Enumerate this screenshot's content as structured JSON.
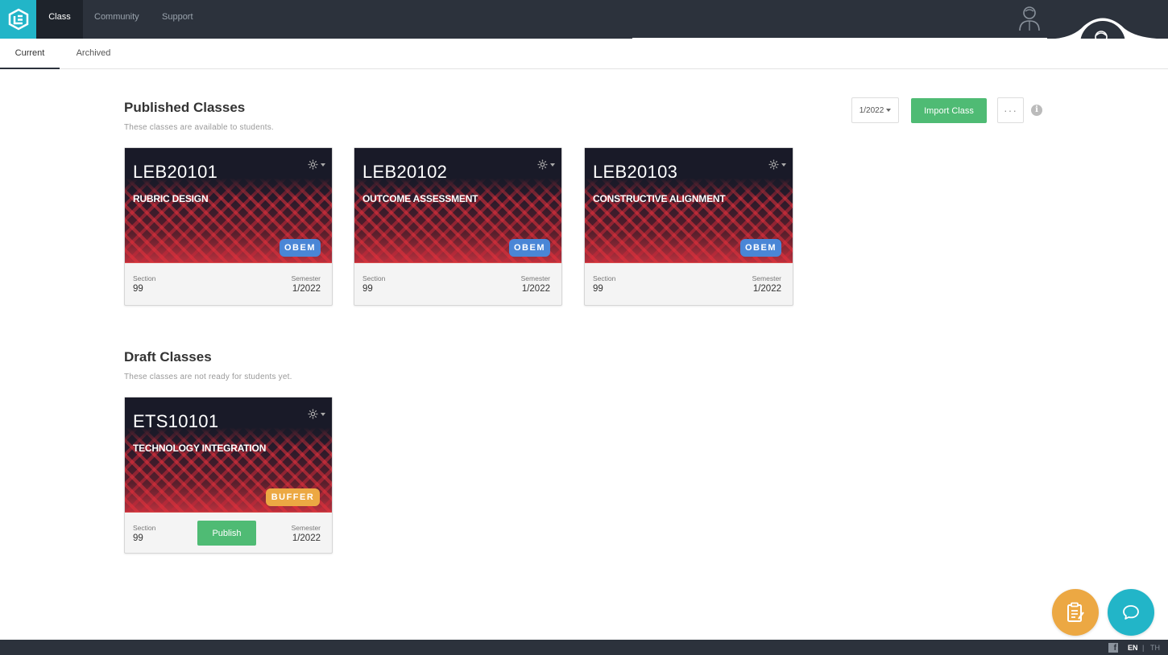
{
  "nav": {
    "items": [
      {
        "label": "Class",
        "active": true
      },
      {
        "label": "Community",
        "active": false
      },
      {
        "label": "Support",
        "active": false
      }
    ]
  },
  "tabs": [
    {
      "label": "Current",
      "active": true
    },
    {
      "label": "Archived",
      "active": false
    }
  ],
  "toolbar": {
    "semester": "1/2022",
    "import_label": "Import Class",
    "more_label": "···",
    "info_label": "i"
  },
  "published": {
    "title": "Published Classes",
    "subtitle": "These classes are available  to students.",
    "cards": [
      {
        "code": "LEB20101",
        "name": "RUBRIC DESIGN",
        "badge": "OBEM",
        "section_label": "Section",
        "section": "99",
        "semester_label": "Semester",
        "semester": "1/2022"
      },
      {
        "code": "LEB20102",
        "name": "OUTCOME ASSESSMENT",
        "badge": "OBEM",
        "section_label": "Section",
        "section": "99",
        "semester_label": "Semester",
        "semester": "1/2022"
      },
      {
        "code": "LEB20103",
        "name": "CONSTRUCTIVE ALIGNMENT",
        "badge": "OBEM",
        "section_label": "Section",
        "section": "99",
        "semester_label": "Semester",
        "semester": "1/2022"
      }
    ]
  },
  "draft": {
    "title": "Draft Classes",
    "subtitle": "These classes are not ready  for students  yet.",
    "cards": [
      {
        "code": "ETS10101",
        "name": "TECHNOLOGY INTEGRATION",
        "badge": "BUFFER",
        "section_label": "Section",
        "section": "99",
        "semester_label": "Semester",
        "semester": "1/2022",
        "publish_label": "Publish"
      }
    ]
  },
  "footer": {
    "lang_en": "EN",
    "lang_sep": "|",
    "lang_th": "TH"
  },
  "colors": {
    "topbar": "#2c323c",
    "accent": "#22b5c8",
    "green": "#4fbb74",
    "obem_badge": "#4a86d6",
    "buffer_badge": "#eca843"
  }
}
